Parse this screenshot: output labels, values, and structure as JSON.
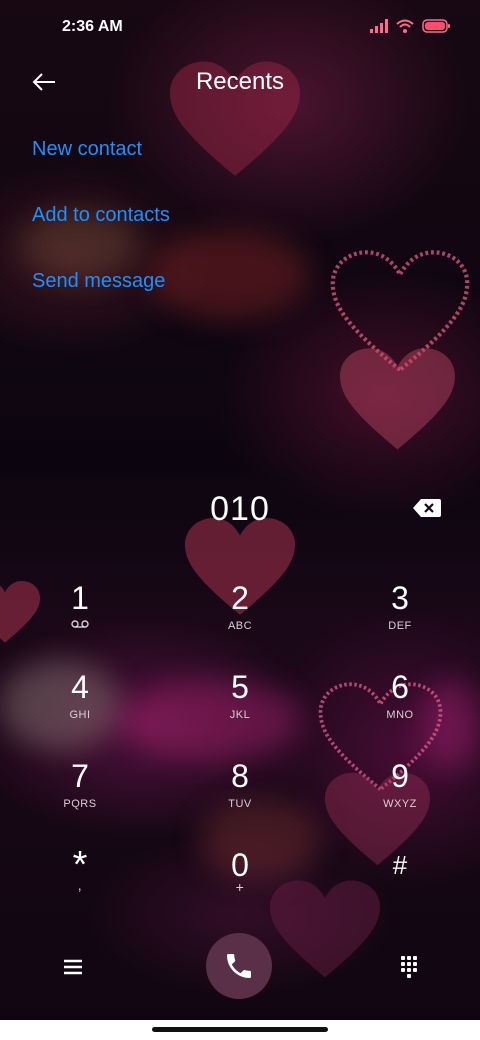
{
  "status_bar": {
    "time": "2:36 AM",
    "icons": [
      "signal-icon",
      "wifi-icon",
      "battery-icon"
    ]
  },
  "header": {
    "title": "Recents"
  },
  "actions": [
    {
      "label": "New contact"
    },
    {
      "label": "Add to contacts"
    },
    {
      "label": "Send message"
    }
  ],
  "dialer": {
    "number": "010"
  },
  "keypad": [
    {
      "digit": "1",
      "sub": "voicemail-icon"
    },
    {
      "digit": "2",
      "sub": "ABC"
    },
    {
      "digit": "3",
      "sub": "DEF"
    },
    {
      "digit": "4",
      "sub": "GHI"
    },
    {
      "digit": "5",
      "sub": "JKL"
    },
    {
      "digit": "6",
      "sub": "MNO"
    },
    {
      "digit": "7",
      "sub": "PQRS"
    },
    {
      "digit": "8",
      "sub": "TUV"
    },
    {
      "digit": "9",
      "sub": "WXYZ"
    },
    {
      "digit": "*",
      "sub": ","
    },
    {
      "digit": "0",
      "sub": "+"
    },
    {
      "digit": "#",
      "sub": ""
    }
  ],
  "colors": {
    "accent": "#1e8fff",
    "call_button": "#5a2f48",
    "battery": "#ff4d6d"
  }
}
